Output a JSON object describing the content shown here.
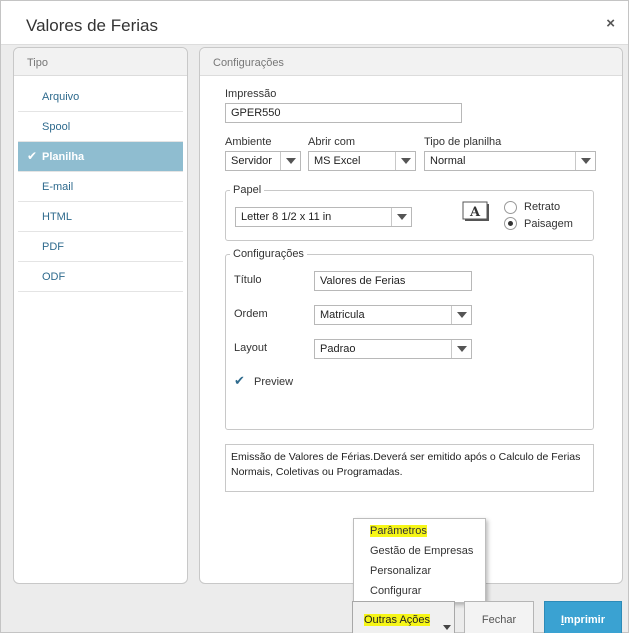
{
  "dialog": {
    "title": "Valores de Ferias",
    "close_glyph": "×"
  },
  "tipo": {
    "header": "Tipo",
    "items": [
      {
        "label": "Arquivo",
        "active": false
      },
      {
        "label": "Spool",
        "active": false
      },
      {
        "label": "Planilha",
        "active": true
      },
      {
        "label": "E-mail",
        "active": false
      },
      {
        "label": "HTML",
        "active": false
      },
      {
        "label": "PDF",
        "active": false
      },
      {
        "label": "ODF",
        "active": false
      }
    ]
  },
  "config": {
    "header": "Configurações",
    "impressao": {
      "label": "Impressão",
      "value": "GPER550"
    },
    "ambiente": {
      "label": "Ambiente",
      "value": "Servidor"
    },
    "abrir_com": {
      "label": "Abrir com",
      "value": "MS Excel"
    },
    "tipo_planilha": {
      "label": "Tipo de planilha",
      "value": "Normal"
    },
    "papel": {
      "legend": "Papel",
      "size": "Letter 8 1/2 x 11 in",
      "retrato": "Retrato",
      "paisagem": "Paisagem",
      "orientation_selected": "Paisagem",
      "font_icon": "font-preview-icon"
    },
    "configuracoes": {
      "legend": "Configurações",
      "titulo": {
        "label": "Título",
        "value": "Valores de Ferias"
      },
      "ordem": {
        "label": "Ordem",
        "value": "Matricula"
      },
      "layout": {
        "label": "Layout",
        "value": "Padrao"
      },
      "preview": {
        "label": "Preview",
        "checked": true
      }
    },
    "description": "Emissão de Valores de Férias.Deverá ser emitido após o Calculo de Ferias Normais, Coletivas ou Programadas."
  },
  "menu": {
    "items": [
      "Parâmetros",
      "Gestão de Empresas",
      "Personalizar",
      "Configurar"
    ]
  },
  "footer": {
    "outras": "Outras Ações",
    "fechar": "Fechar",
    "imprimir": "Imprimir"
  },
  "colors": {
    "active_tab_bg": "#8fbdd0",
    "link": "#2e6a8d",
    "primary": "#3aa2d2",
    "highlight": "#f6f617"
  }
}
